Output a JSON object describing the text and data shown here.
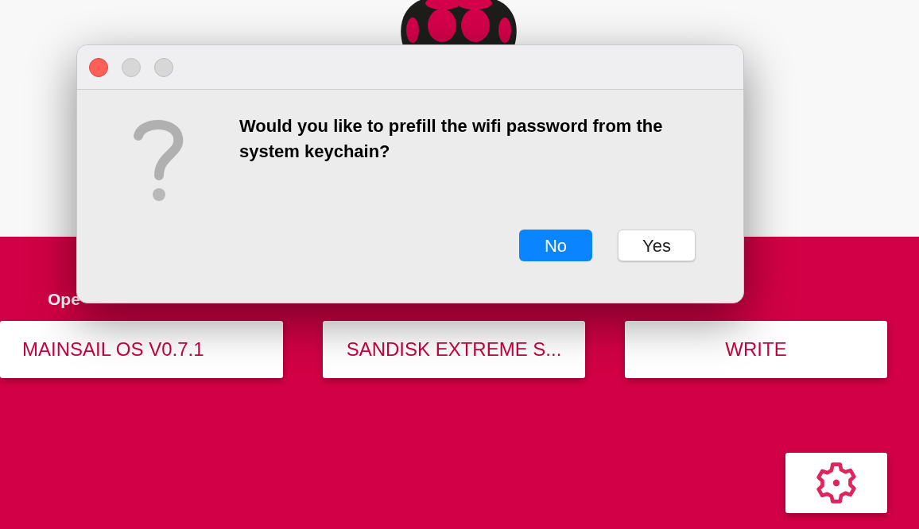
{
  "main": {
    "section_label": "Ope",
    "buttons": [
      {
        "label": "MAINSAIL OS V0.7.1"
      },
      {
        "label": "SANDISK EXTREME S..."
      },
      {
        "label": "WRITE"
      }
    ]
  },
  "dialog": {
    "window_controls": [
      {
        "kind": "close",
        "color": "#fe5f57"
      },
      {
        "kind": "minimize",
        "color": "#d7d7d7"
      },
      {
        "kind": "zoom",
        "color": "#d7d7d7"
      }
    ],
    "message": "Would you like to prefill the wifi password from the system keychain?",
    "buttons": [
      {
        "label": "No",
        "selected": true
      },
      {
        "label": "Yes",
        "selected": false
      }
    ]
  }
}
